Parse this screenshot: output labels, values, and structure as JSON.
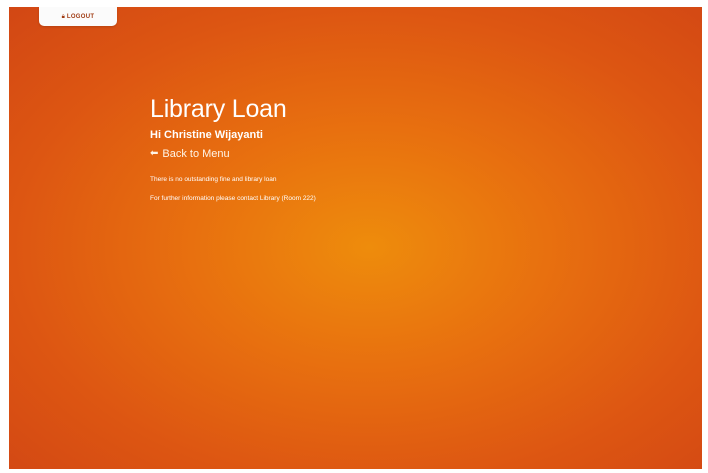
{
  "header": {
    "logout_label": "LOGOUT",
    "logout_icon": "lock-icon"
  },
  "main": {
    "title": "Library Loan",
    "greeting": "Hi Christine Wijayanti",
    "back_label": "Back to Menu",
    "back_icon": "arrow-left-icon",
    "status_message": "There is no outstanding fine and library loan",
    "contact_message": "For further information please contact Library (Room 222)"
  },
  "colors": {
    "background_center": "#ee8c0c",
    "background_edge": "#d24714",
    "text": "#ffffff",
    "tab_background": "#fbfbfb"
  }
}
